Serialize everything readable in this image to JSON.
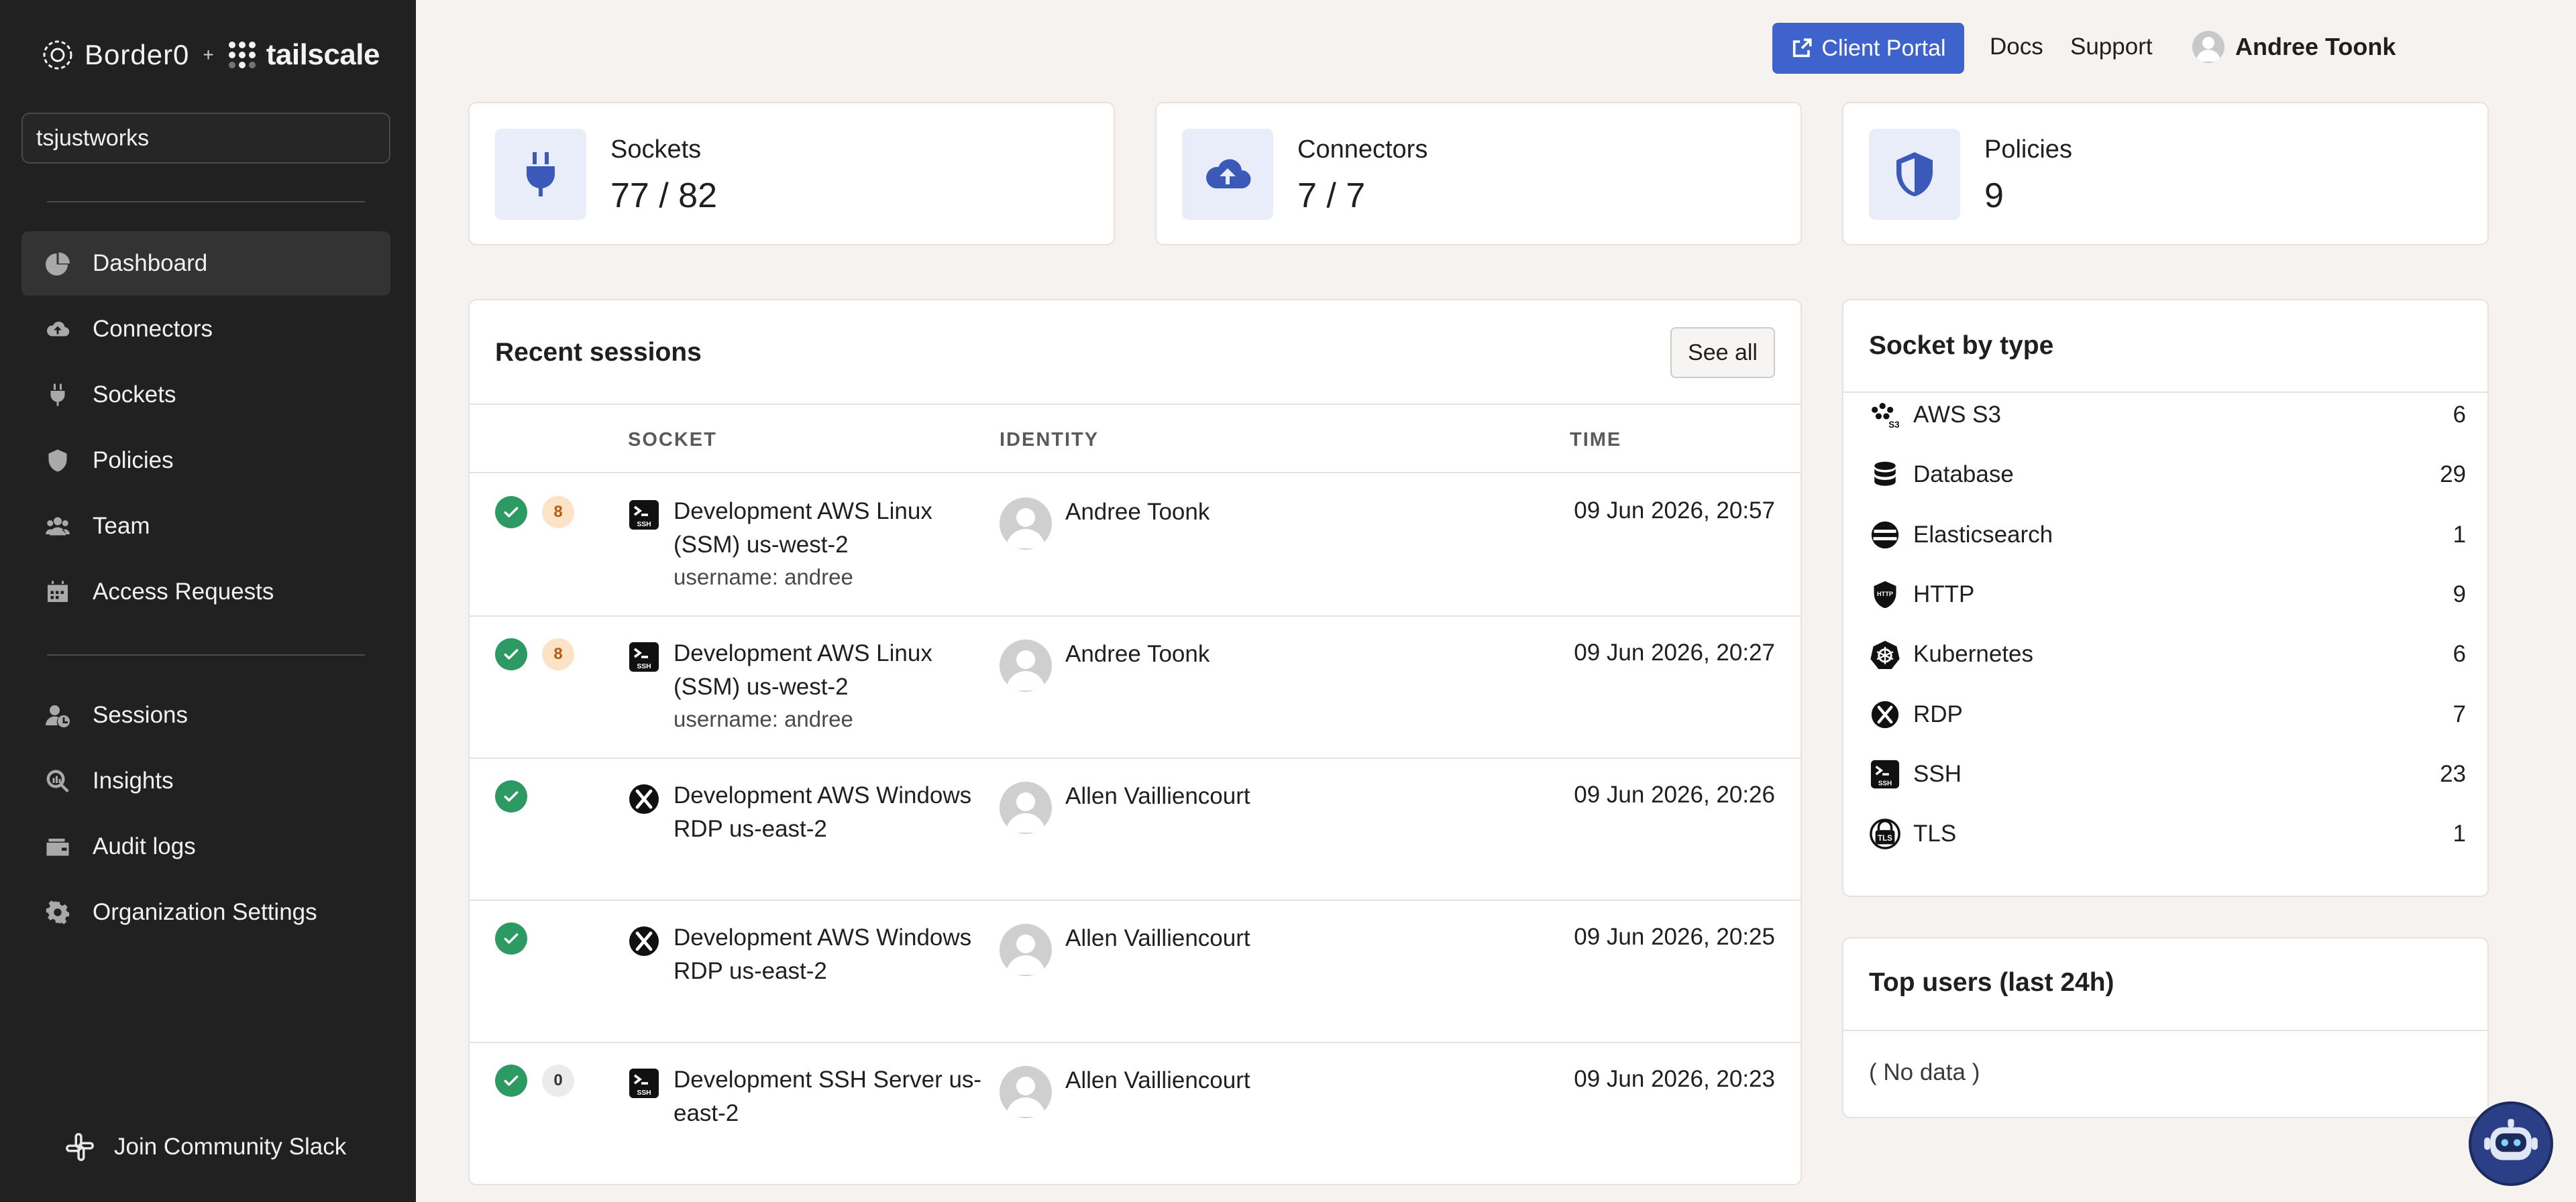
{
  "brand": {
    "primary": "Border0",
    "plus": "+",
    "secondary": "tailscale"
  },
  "org": {
    "value": "tsjustworks"
  },
  "nav": {
    "main": [
      {
        "label": "Dashboard",
        "icon": "chart-pie-icon",
        "active": true
      },
      {
        "label": "Connectors",
        "icon": "cloud-upload-icon"
      },
      {
        "label": "Sockets",
        "icon": "plug-icon"
      },
      {
        "label": "Policies",
        "icon": "shield-icon"
      },
      {
        "label": "Team",
        "icon": "users-icon"
      },
      {
        "label": "Access Requests",
        "icon": "calendar-icon"
      }
    ],
    "secondary": [
      {
        "label": "Sessions",
        "icon": "user-clock-icon"
      },
      {
        "label": "Insights",
        "icon": "magnify-chart-icon"
      },
      {
        "label": "Audit logs",
        "icon": "wallet-icon"
      },
      {
        "label": "Organization Settings",
        "icon": "gear-icon"
      }
    ],
    "slack_label": "Join Community Slack"
  },
  "topbar": {
    "portal_label": "Client Portal",
    "docs_label": "Docs",
    "support_label": "Support",
    "user_name": "Andree Toonk"
  },
  "stats": [
    {
      "title": "Sockets",
      "value": "77 / 82",
      "icon": "plug-icon"
    },
    {
      "title": "Connectors",
      "value": "7 / 7",
      "icon": "cloud-upload-icon"
    },
    {
      "title": "Policies",
      "value": "9",
      "icon": "shield-icon"
    }
  ],
  "sessions": {
    "title": "Recent sessions",
    "see_all_label": "See all",
    "columns": {
      "socket": "SOCKET",
      "identity": "IDENTITY",
      "time": "TIME"
    },
    "rows": [
      {
        "count": "8",
        "count_style": "orange",
        "type": "ssh",
        "socket": "Development AWS Linux (SSM) us-west-2",
        "sub": "username: andree",
        "identity": "Andree Toonk",
        "time": "09 Jun 2026, 20:57"
      },
      {
        "count": "8",
        "count_style": "orange",
        "type": "ssh",
        "socket": "Development AWS Linux (SSM) us-west-2",
        "sub": "username: andree",
        "identity": "Andree Toonk",
        "time": "09 Jun 2026, 20:27"
      },
      {
        "count": "",
        "count_style": "",
        "type": "rdp",
        "socket": "Development AWS Windows RDP us-east-2",
        "sub": "",
        "identity": "Allen Vailliencourt",
        "time": "09 Jun 2026, 20:26"
      },
      {
        "count": "",
        "count_style": "",
        "type": "rdp",
        "socket": "Development AWS Windows RDP us-east-2",
        "sub": "",
        "identity": "Allen Vailliencourt",
        "time": "09 Jun 2026, 20:25"
      },
      {
        "count": "0",
        "count_style": "gray",
        "type": "ssh",
        "socket": "Development SSH Server us-east-2",
        "sub": "",
        "identity": "Allen Vailliencourt",
        "time": "09 Jun 2026, 20:23"
      }
    ]
  },
  "socket_types": {
    "title": "Socket by type",
    "items": [
      {
        "label": "AWS S3",
        "count": "6",
        "icon": "aws-s3-icon"
      },
      {
        "label": "Database",
        "count": "29",
        "icon": "database-icon"
      },
      {
        "label": "Elasticsearch",
        "count": "1",
        "icon": "elasticsearch-icon"
      },
      {
        "label": "HTTP",
        "count": "9",
        "icon": "http-shield-icon"
      },
      {
        "label": "Kubernetes",
        "count": "6",
        "icon": "kubernetes-icon"
      },
      {
        "label": "RDP",
        "count": "7",
        "icon": "rdp-icon"
      },
      {
        "label": "SSH",
        "count": "23",
        "icon": "ssh-terminal-icon"
      },
      {
        "label": "TLS",
        "count": "1",
        "icon": "tls-icon"
      }
    ]
  },
  "top_users": {
    "title": "Top users (last 24h)",
    "empty": "( No data )"
  },
  "colors": {
    "sidebar": "#212121",
    "accent": "#3f63cc",
    "success": "#2e9a63",
    "badge_orange": "#fde3c6"
  }
}
